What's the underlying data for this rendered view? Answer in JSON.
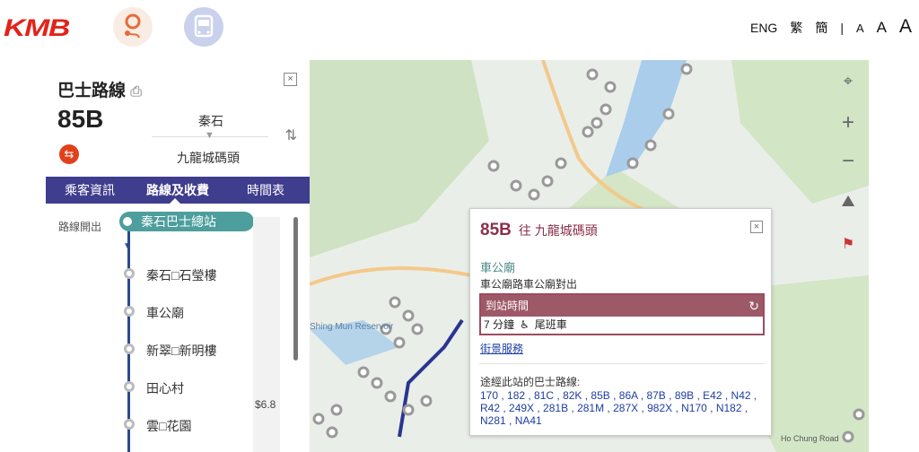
{
  "header": {
    "logo": "KMB",
    "lang": {
      "eng": "ENG",
      "trad": "繁",
      "simp": "簡",
      "sep": "|",
      "font_small": "A",
      "font_medium": "A",
      "font_large": "A"
    }
  },
  "panel": {
    "title": "巴士路線",
    "route": "85B",
    "origin": "秦石",
    "destination": "九龍城碼頭",
    "tabs": [
      "乘客資訊",
      "路線及收費",
      "時間表"
    ],
    "start_label": "路線開出",
    "first_stop": "秦石巴士總站",
    "stops": [
      "秦石□石瑩樓",
      "車公廟",
      "新翠□新明樓",
      "田心村",
      "雲□花園"
    ],
    "fare": "$6.8"
  },
  "map": {
    "label_reservoir": "Shing Mun Reservoir",
    "label_road": "Ho Chung Road"
  },
  "popup": {
    "route": "85B",
    "direction": "往 九龍城碼頭",
    "stop_name": "車公廟",
    "stop_addr": "車公廟路車公廟對出",
    "eta_label": "到站時間",
    "eta_minutes": "7 分鐘",
    "eta_note": "尾班車",
    "street_view": "街景服務",
    "passing_label": "途經此站的巴士路線:",
    "passing_routes": "170 , 182 , 81C , 82K , 85B , 86A , 87B , 89B , E42 , N42 , R42 , 249X , 281B , 281M , 287X , 982X , N170 , N182 , N281 , NA41"
  },
  "colors": {
    "accent": "#3f3d8d",
    "kmb_red": "#e2231a",
    "route_color": "#8b2f4b",
    "stop_teal": "#4d9e9c"
  }
}
